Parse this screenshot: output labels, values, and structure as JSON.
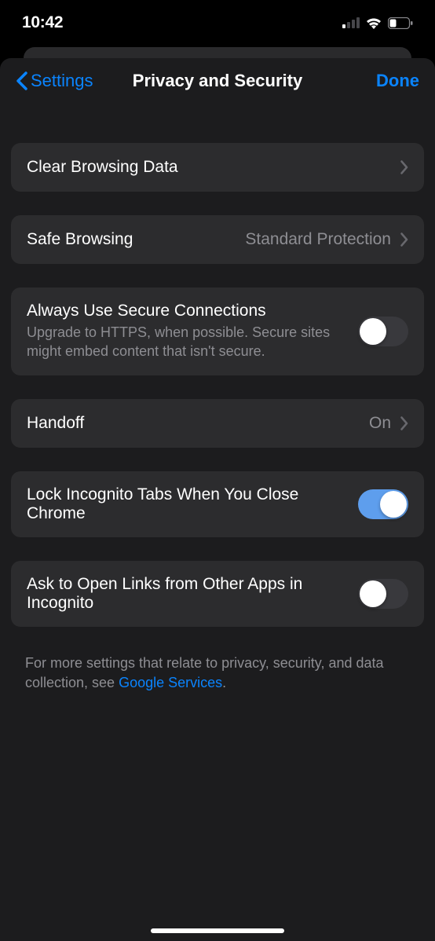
{
  "statusBar": {
    "time": "10:42"
  },
  "nav": {
    "back": "Settings",
    "title": "Privacy and Security",
    "done": "Done"
  },
  "rows": {
    "clearBrowsing": "Clear Browsing Data",
    "safeBrowsing": {
      "label": "Safe Browsing",
      "value": "Standard Protection"
    },
    "secureConnections": {
      "label": "Always Use Secure Connections",
      "sub": "Upgrade to HTTPS, when possible. Secure sites might embed content that isn't secure.",
      "on": false
    },
    "handoff": {
      "label": "Handoff",
      "value": "On"
    },
    "lockIncognito": {
      "label": "Lock Incognito Tabs When You Close Chrome",
      "on": true
    },
    "askOpenLinks": {
      "label": "Ask to Open Links from Other Apps in Incognito",
      "on": false
    }
  },
  "footer": {
    "textBefore": "For more settings that relate to privacy, security, and data collection, see ",
    "link": "Google Services",
    "textAfter": "."
  }
}
